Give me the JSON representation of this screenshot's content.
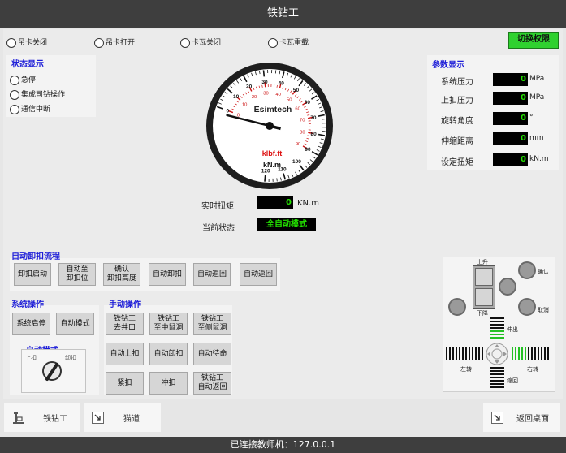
{
  "title": "铁钻工",
  "top_radios": [
    "吊卡关闭",
    "吊卡打开",
    "卡瓦关闭",
    "卡瓦重载"
  ],
  "auth_button": "切换权限",
  "status_display": {
    "title": "状态显示",
    "items": [
      "急停",
      "集成司钻操作",
      "通信中断"
    ]
  },
  "params": {
    "title": "参数显示",
    "rows": [
      {
        "label": "系统压力",
        "value": "0",
        "unit": "MPa"
      },
      {
        "label": "上扣压力",
        "value": "0",
        "unit": "MPa"
      },
      {
        "label": "旋转角度",
        "value": "0",
        "unit": "°"
      },
      {
        "label": "伸缩距离",
        "value": "0",
        "unit": "mm"
      },
      {
        "label": "设定扭矩",
        "value": "0",
        "unit": "kN.m"
      }
    ]
  },
  "gauge": {
    "brand": "Esimtech",
    "unit1": "klbf.ft",
    "unit2": "kN.m",
    "outer_ticks": [
      "0",
      "10",
      "20",
      "30",
      "40",
      "50",
      "60",
      "70",
      "80",
      "90",
      "100",
      "110",
      "120"
    ],
    "inner_ticks": [
      "0",
      "10",
      "20",
      "30",
      "40",
      "50",
      "60",
      "70",
      "80",
      "90"
    ],
    "needle_value": 0
  },
  "realtime": {
    "label": "实时扭矩",
    "value": "0",
    "unit": "KN.m"
  },
  "current_state": {
    "label": "当前状态",
    "value": "全自动模式"
  },
  "auto_flow": {
    "title": "自动卸扣流程",
    "buttons": [
      "卸扣启动",
      "自动至\n卸扣位",
      "确认\n卸扣高度",
      "自动卸扣",
      "自动返回",
      "自动返回"
    ]
  },
  "system_ops": {
    "title": "系统操作",
    "buttons": [
      "系统启停",
      "自动模式"
    ]
  },
  "auto_mode": {
    "title": "自动模式",
    "left": "上扣",
    "right": "卸扣"
  },
  "manual_ops": {
    "title": "手动操作",
    "buttons": [
      "铁钻工\n去井口",
      "铁钻工\n至中鼠洞",
      "铁钻工\n至侧鼠洞",
      "自动上扣",
      "自动卸扣",
      "自动待命",
      "紧扣",
      "冲扣",
      "铁钻工\n自动返回"
    ]
  },
  "joystick": {
    "up": "上升",
    "down": "下降",
    "confirm": "确认",
    "cancel": "取消",
    "extend": "伸出",
    "retract": "缩回",
    "left": "左转",
    "right": "右转"
  },
  "nav": {
    "item1": "铁钻工",
    "item2": "猫道",
    "item3": "返回桌面"
  },
  "status_bar": "已连接教师机：127.0.0.1"
}
